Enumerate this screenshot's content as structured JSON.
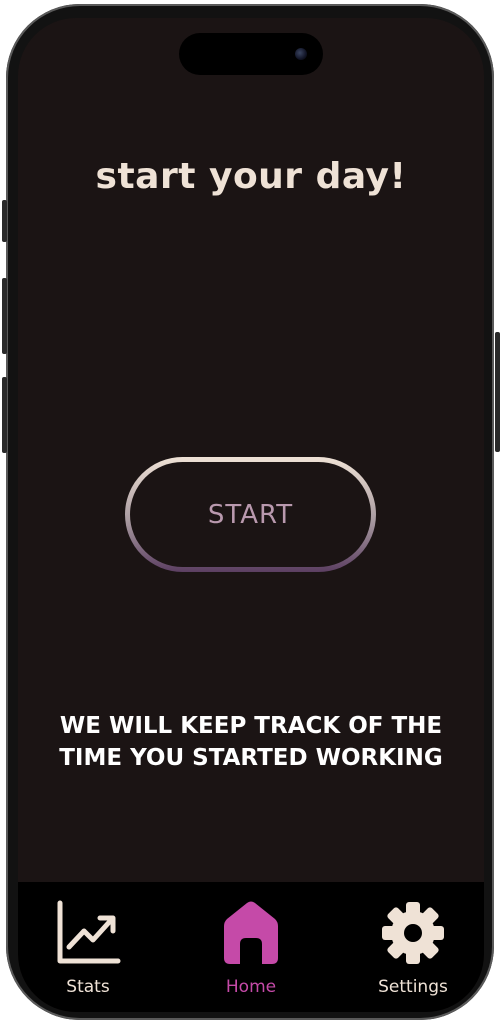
{
  "screen": {
    "title": "start your day!",
    "start_button_label": "START",
    "info_text": "WE WILL KEEP TRACK OF THE TIME YOU STARTED WORKING"
  },
  "tabbar": {
    "tabs": [
      {
        "label": "Stats",
        "icon": "chart-trend-icon",
        "active": false
      },
      {
        "label": "Home",
        "icon": "home-icon",
        "active": true
      },
      {
        "label": "Settings",
        "icon": "gear-icon",
        "active": false
      }
    ]
  },
  "colors": {
    "background": "#1b1414",
    "cream": "#efe2d6",
    "accent_pink": "#c54aa8",
    "start_text": "#b999ae",
    "tabbar": "#000000"
  }
}
